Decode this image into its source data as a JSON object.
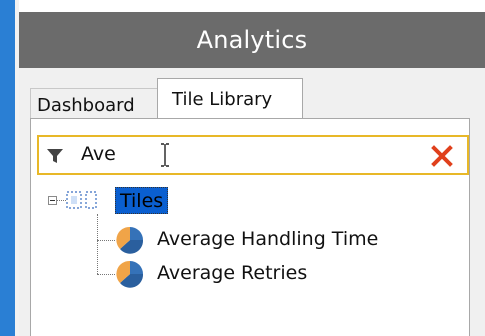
{
  "window": {
    "title": "Analytics"
  },
  "tabs": [
    {
      "label": "Dashboard",
      "active": false
    },
    {
      "label": "Tile Library",
      "active": true
    }
  ],
  "search": {
    "value": "Ave"
  },
  "tree": {
    "root": {
      "label": "Tiles",
      "selected": true,
      "expanded": true,
      "icon": "tiles-icon"
    },
    "items": [
      {
        "label": "Average Handling Time",
        "icon": "pie-chart-icon"
      },
      {
        "label": "Average Retries",
        "icon": "pie-chart-icon"
      }
    ]
  },
  "colors": {
    "accent_left_bar": "#2a7fd4",
    "title_bar": "#6b6b6b",
    "search_border": "#e8b828",
    "selection": "#0a5fd0",
    "clear_x": "#e0401c"
  }
}
